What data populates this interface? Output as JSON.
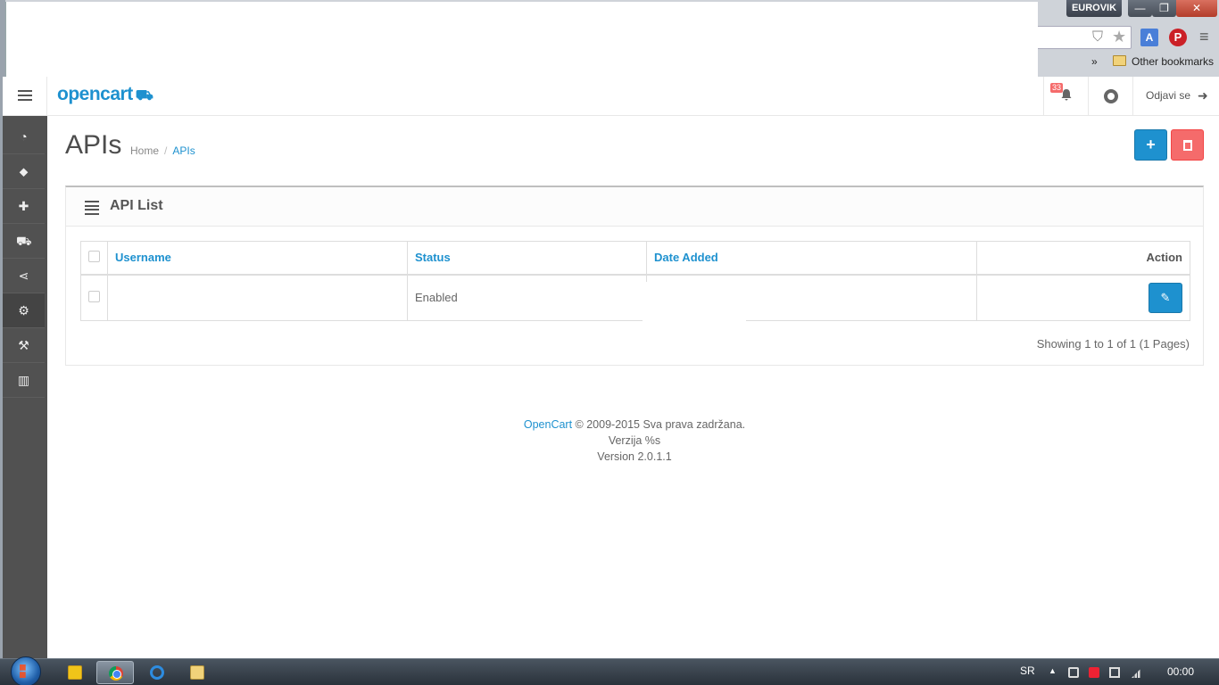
{
  "browser": {
    "profile_name": "EUROVIK",
    "window_min": "—",
    "window_max": "❐",
    "window_close": "✕",
    "bookmarks_chevron": "»",
    "other_bookmarks": "Other bookmarks"
  },
  "header": {
    "logo_text": "opencart",
    "notification_count": "33",
    "logout_label": "Odjavi se"
  },
  "sidebar": {
    "items": [
      {
        "icon": "dashboard-icon",
        "active": false
      },
      {
        "icon": "tags-icon",
        "active": false
      },
      {
        "icon": "puzzle-icon",
        "active": false
      },
      {
        "icon": "cart-icon",
        "active": false
      },
      {
        "icon": "share-icon",
        "active": false
      },
      {
        "icon": "gear-icon",
        "active": true
      },
      {
        "icon": "wrench-icon",
        "active": false
      },
      {
        "icon": "bar-chart-icon",
        "active": false
      }
    ]
  },
  "page": {
    "title": "APIs",
    "breadcrumb_home": "Home",
    "breadcrumb_sep": "/",
    "breadcrumb_current": "APIs"
  },
  "panel": {
    "title": "API List"
  },
  "table": {
    "headers": {
      "username": "Username",
      "status": "Status",
      "date_added": "Date Added",
      "action": "Action"
    },
    "rows": [
      {
        "username": "",
        "status": "Enabled",
        "date_added": ""
      }
    ]
  },
  "pagination": {
    "info": "Showing 1 to 1 of 1 (1 Pages)"
  },
  "footer": {
    "brand_link": "OpenCart",
    "copyright": " © 2009-2015 Sva prava zadržana.",
    "version_line1": "Verzija %s",
    "version_line2": "Version 2.0.1.1"
  },
  "taskbar": {
    "language": "SR",
    "tray_arrow": "▲",
    "clock": "00:00"
  },
  "colors": {
    "primary": "#1e91cf",
    "danger": "#f56b6b",
    "sidebar": "#515151"
  }
}
